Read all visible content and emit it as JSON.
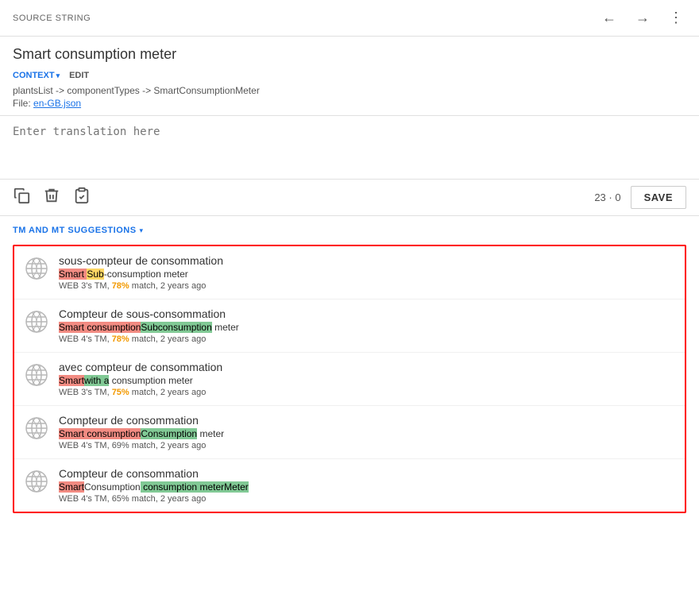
{
  "topbar": {
    "label": "SOURCE STRING",
    "back_icon": "←",
    "forward_icon": "→",
    "more_icon": "⋮"
  },
  "source": {
    "title": "Smart consumption meter",
    "context_label": "CONTEXT",
    "edit_label": "EDIT",
    "breadcrumb": "plantsList -> componentTypes -> SmartConsumptionMeter",
    "file_prefix": "File: ",
    "file_link": "en-GB.json"
  },
  "translation": {
    "placeholder": "Enter translation here"
  },
  "toolbar": {
    "copy_icon": "copy",
    "delete_icon": "delete",
    "paste_icon": "paste",
    "counter": "23 · 0",
    "save_label": "SAVE"
  },
  "suggestions_section": {
    "label": "TM AND MT SUGGESTIONS",
    "items": [
      {
        "target": "sous-compteur de consommation",
        "source_parts": [
          {
            "text": "Smart ",
            "hl": "red"
          },
          {
            "text": "Sub",
            "hl": "yellow"
          },
          {
            "text": "-consumption meter",
            "hl": "none"
          }
        ],
        "meta": "WEB 3's TM, 78% match, 2 years ago",
        "match_pct": "78%",
        "match_class": "match-78"
      },
      {
        "target": "Compteur de sous-consommation",
        "source_parts": [
          {
            "text": "Smart consumption",
            "hl": "red"
          },
          {
            "text": "Subconsumption",
            "hl": "green"
          },
          {
            "text": " meter",
            "hl": "none"
          }
        ],
        "meta": "WEB 4's TM, 78% match, 2 years ago",
        "match_pct": "78%",
        "match_class": "match-78"
      },
      {
        "target": "avec compteur de consommation",
        "source_parts": [
          {
            "text": "Smart",
            "hl": "red"
          },
          {
            "text": "with a",
            "hl": "green"
          },
          {
            "text": " consumption meter",
            "hl": "none"
          }
        ],
        "meta": "WEB 3's TM, 75% match, 2 years ago",
        "match_pct": "75%",
        "match_class": "match-75"
      },
      {
        "target": "Compteur de consommation",
        "source_parts": [
          {
            "text": "Smart consumption",
            "hl": "red"
          },
          {
            "text": "Consumption",
            "hl": "green"
          },
          {
            "text": " meter",
            "hl": "none"
          }
        ],
        "meta": "WEB 4's TM, 69% match, 2 years ago",
        "match_pct": "69%",
        "match_class": "match-69"
      },
      {
        "target": "Compteur de consommation",
        "source_parts": [
          {
            "text": "Smart",
            "hl": "red"
          },
          {
            "text": "Consumption",
            "hl": "none"
          },
          {
            "text": " consumption meter",
            "hl": "green"
          },
          {
            "text": "Meter",
            "hl": "green"
          }
        ],
        "meta": "WEB 4's TM, 65% match, 2 years ago",
        "match_pct": "65%",
        "match_class": "match-65"
      }
    ]
  }
}
